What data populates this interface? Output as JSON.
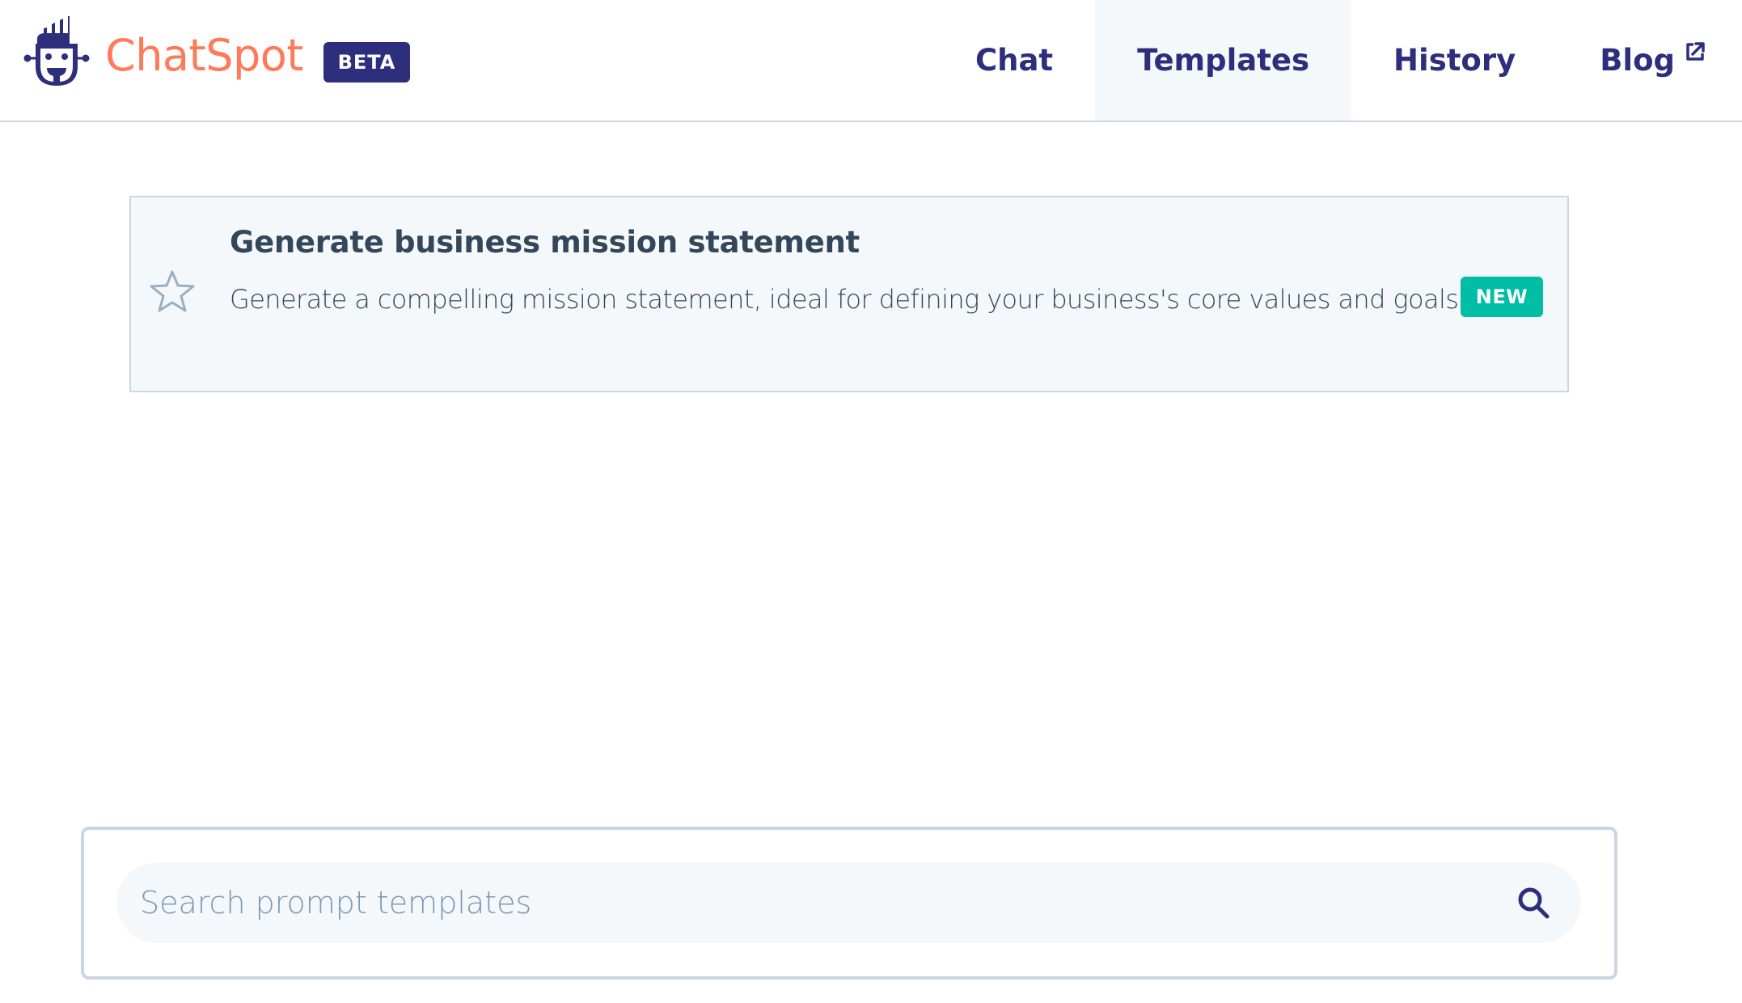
{
  "app": {
    "name": "ChatSpot",
    "badge": "BETA",
    "brand_color": "#ff7a59",
    "navy_color": "#2d2e7c"
  },
  "nav": {
    "items": [
      {
        "label": "Chat",
        "active": false
      },
      {
        "label": "Templates",
        "active": true
      },
      {
        "label": "History",
        "active": false
      },
      {
        "label": "Blog",
        "active": false,
        "icon": "external-link-icon"
      }
    ]
  },
  "templates": [
    {
      "title": "Generate business mission statement",
      "description": "Generate a compelling mission statement, ideal for defining your business's core values and goals",
      "badge": "NEW",
      "badge_color": "#00bda5",
      "favorite": false,
      "icon": "star-outline-icon"
    }
  ],
  "search": {
    "placeholder": "Search prompt templates",
    "value": "",
    "icon": "search-icon"
  }
}
